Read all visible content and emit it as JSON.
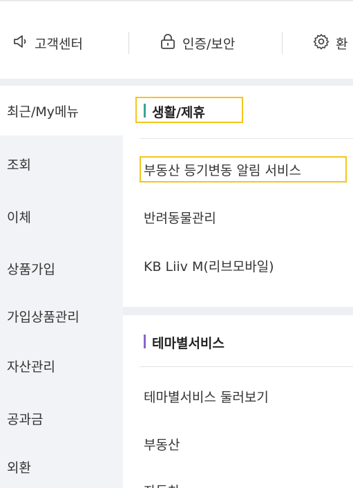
{
  "quick_menu": {
    "items": [
      {
        "label": "고객센터",
        "icon": "speaker-icon"
      },
      {
        "label": "인증/보안",
        "icon": "lock-icon"
      },
      {
        "label": "환",
        "icon": "gear-icon"
      }
    ]
  },
  "left_nav": {
    "items": [
      {
        "label": "최근/My메뉴"
      },
      {
        "label": "조회"
      },
      {
        "label": "이체"
      },
      {
        "label": "상품가입"
      },
      {
        "label": "가입상품관리"
      },
      {
        "label": "자산관리"
      },
      {
        "label": "공과금"
      },
      {
        "label": "외환"
      }
    ]
  },
  "sections": [
    {
      "title": "생활/제휴",
      "accent": "#3aa39a",
      "links": [
        "부동산 등기변동 알림 서비스",
        "반려동물관리",
        "KB Liiv M(리브모바일)"
      ]
    },
    {
      "title": "테마별서비스",
      "accent": "#8a66c9",
      "links": [
        "테마별서비스 둘러보기",
        "부동산",
        "자동차"
      ]
    }
  ],
  "highlight_color": "#f5c518"
}
